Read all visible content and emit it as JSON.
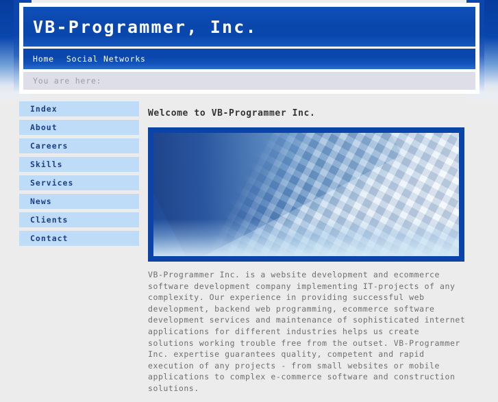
{
  "site": {
    "title": "VB-Programmer, Inc."
  },
  "nav": {
    "items": [
      {
        "label": "Home"
      },
      {
        "label": "Social Networks"
      }
    ]
  },
  "breadcrumb": {
    "label": "You are here:"
  },
  "sidebar": {
    "items": [
      {
        "label": "Index"
      },
      {
        "label": "About"
      },
      {
        "label": "Careers"
      },
      {
        "label": "Skills"
      },
      {
        "label": "Services"
      },
      {
        "label": "News"
      },
      {
        "label": "Clients"
      },
      {
        "label": "Contact"
      }
    ]
  },
  "main": {
    "heading": "Welcome to VB-Programmer Inc.",
    "hero_image_alt": "keyboard-photo",
    "paragraph": "VB-Programmer Inc. is a website development and ecommerce software development company implementing IT-projects of any complexity. Our experience in providing successful web development, backend web programming, ecommerce software development services and maintenance of sophisticated internet applications for different industries helps us create solutions working trouble free from the outset. VB-Programmer Inc. expertise guarantees quality, competent and rapid execution of any projects - from small websites or mobile applications to complex e-commerce software and construction solutions."
  },
  "colors": {
    "brand_blue": "#0a47ad",
    "image_border": "#0a44a8",
    "sidebar_item": "#bedcf7",
    "sidebar_text": "#1b3f86",
    "breadcrumb_bar": "#dedee9",
    "page_background": "#ececec",
    "body_text": "#6e6e6e"
  }
}
